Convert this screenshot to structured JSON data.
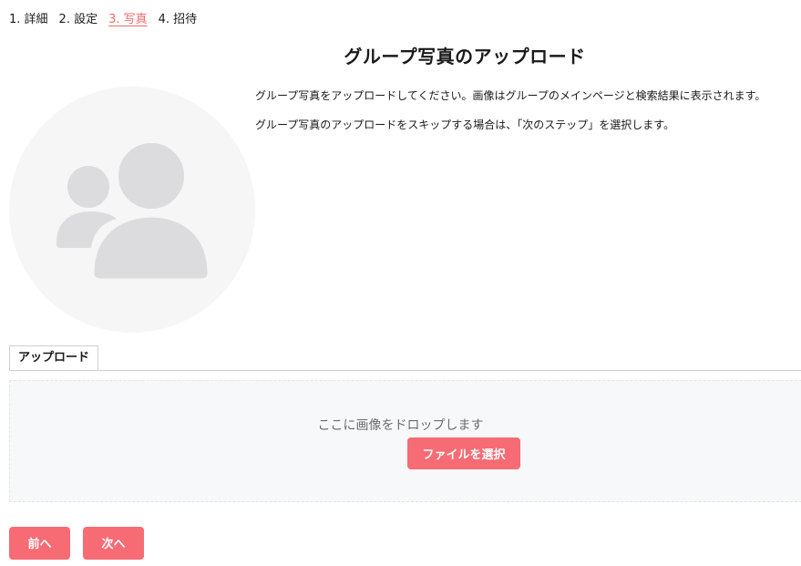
{
  "steps": [
    {
      "label": "1. 詳細"
    },
    {
      "label": "2. 設定"
    },
    {
      "label": "3. 写真"
    },
    {
      "label": "4. 招待"
    }
  ],
  "page": {
    "title": "グループ写真のアップロード",
    "description_1": "グループ写真をアップロードしてください。画像はグループのメインページと検索結果に表示されます。",
    "description_2": "グループ写真のアップロードをスキップする場合は、「次のステップ」を選択します。"
  },
  "upload": {
    "tab_label": "アップロード",
    "drop_text": "ここに画像をドロップします",
    "select_label": "ファイルを選択"
  },
  "nav": {
    "prev_label": "前へ",
    "next_label": "次へ"
  },
  "colors": {
    "accent": "#f66b74",
    "active_step": "#f26a6a",
    "avatar_bg": "#f6f6f7",
    "avatar_icon": "#dcdcde"
  },
  "icons": {
    "avatar": "group-users-icon"
  }
}
